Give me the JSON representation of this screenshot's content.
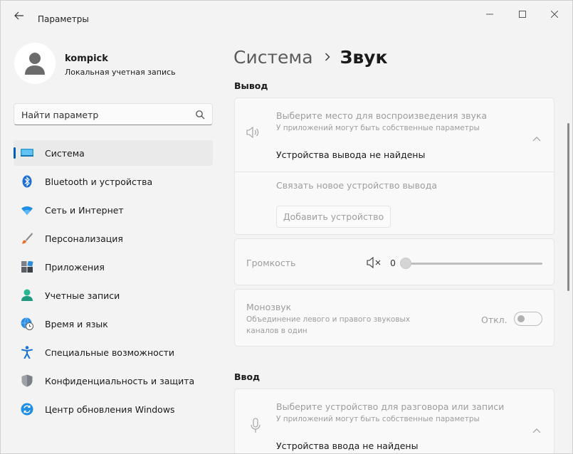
{
  "window": {
    "title": "Параметры"
  },
  "profile": {
    "name": "kompick",
    "account_type": "Локальная учетная запись"
  },
  "search": {
    "placeholder": "Найти параметр"
  },
  "nav": {
    "items": [
      {
        "label": "Система",
        "icon": "system-icon",
        "active": true
      },
      {
        "label": "Bluetooth и устройства",
        "icon": "bluetooth-icon"
      },
      {
        "label": "Сеть и Интернет",
        "icon": "wifi-icon"
      },
      {
        "label": "Персонализация",
        "icon": "brush-icon"
      },
      {
        "label": "Приложения",
        "icon": "apps-icon"
      },
      {
        "label": "Учетные записи",
        "icon": "account-icon"
      },
      {
        "label": "Время и язык",
        "icon": "globe-clock-icon"
      },
      {
        "label": "Специальные возможности",
        "icon": "accessibility-icon"
      },
      {
        "label": "Конфиденциальность и защита",
        "icon": "shield-icon"
      },
      {
        "label": "Центр обновления Windows",
        "icon": "update-icon"
      }
    ]
  },
  "breadcrumb": {
    "parent": "Система",
    "current": "Звук"
  },
  "output": {
    "section_title": "Вывод",
    "choose_title": "Выберите место для воспроизведения звука",
    "choose_sub": "У приложений могут быть собственные параметры",
    "no_devices": "Устройства вывода не найдены",
    "pair_new": "Связать новое устройство вывода",
    "add_device": "Добавить устройство"
  },
  "volume": {
    "label": "Громкость",
    "value": "0"
  },
  "mono": {
    "title": "Монозвук",
    "desc_line1": "Объединение левого и правого звуковых",
    "desc_line2": "каналов в один",
    "state": "Откл."
  },
  "input": {
    "section_title": "Ввод",
    "choose_title": "Выберите устройство для разговора или записи",
    "choose_sub": "У приложений могут быть собственные параметры",
    "no_devices": "Устройства ввода не найдены"
  },
  "colors": {
    "accent": "#005fb8",
    "muted_text": "#9d9d9d",
    "card_bg": "#f9f9f9"
  }
}
